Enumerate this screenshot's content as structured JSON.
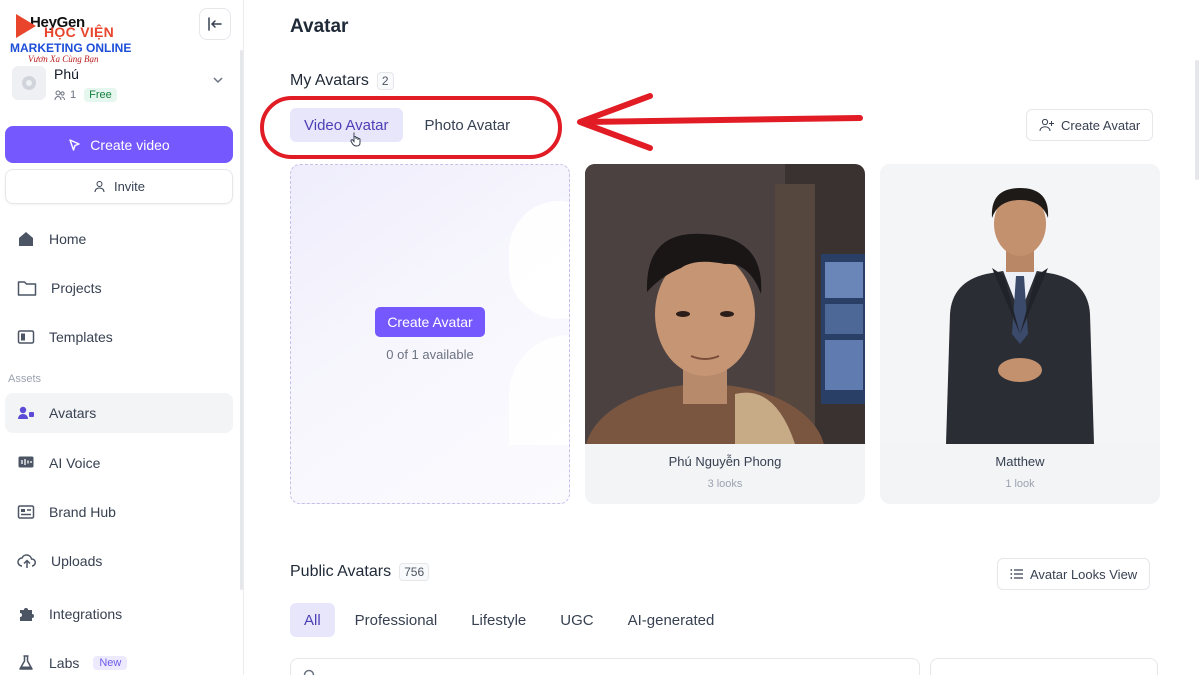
{
  "logo": {
    "heygen_text": "HeyGen",
    "hoc_vien": "HỌC VIỆN",
    "marketing_online": "MARKETING ONLINE",
    "tagline": "Vươn Xa Cùng Bạn"
  },
  "workspace": {
    "name": "Phú",
    "members": "1",
    "plan": "Free"
  },
  "sidebar": {
    "create_video": "Create video",
    "invite": "Invite",
    "section_assets": "Assets",
    "items": [
      {
        "label": "Home",
        "icon": "home-icon"
      },
      {
        "label": "Projects",
        "icon": "folder-icon"
      },
      {
        "label": "Templates",
        "icon": "templates-icon"
      },
      {
        "label": "Avatars",
        "icon": "avatar-icon"
      },
      {
        "label": "AI Voice",
        "icon": "voice-icon"
      },
      {
        "label": "Brand Hub",
        "icon": "brand-icon"
      },
      {
        "label": "Uploads",
        "icon": "upload-icon"
      },
      {
        "label": "Integrations",
        "icon": "puzzle-icon"
      },
      {
        "label": "Labs",
        "icon": "flask-icon",
        "badge": "New"
      }
    ]
  },
  "main": {
    "title": "Avatar",
    "my_avatars": {
      "title": "My Avatars",
      "count": "2",
      "tabs": [
        "Video Avatar",
        "Photo Avatar"
      ],
      "active_tab": "Video Avatar",
      "create_button": "Create Avatar",
      "create_card": {
        "button": "Create Avatar",
        "availability": "0 of 1 available"
      },
      "avatars": [
        {
          "name": "Phú Nguyễn Phong",
          "looks": "3 looks"
        },
        {
          "name": "Matthew",
          "looks": "1 look"
        }
      ]
    },
    "public_avatars": {
      "title": "Public Avatars",
      "count": "756",
      "view_button": "Avatar Looks View",
      "filters": [
        "All",
        "Professional",
        "Lifestyle",
        "UGC",
        "AI-generated"
      ],
      "active_filter": "All"
    }
  },
  "colors": {
    "accent": "#7559ff",
    "annotation": "#e21c25"
  }
}
